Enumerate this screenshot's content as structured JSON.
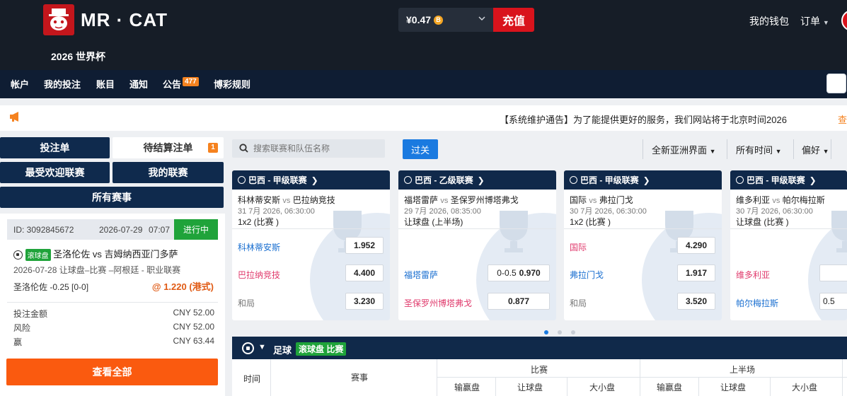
{
  "header": {
    "brand": "MR · CAT",
    "subtitle": "2026 世界杯",
    "balance": "¥0.47",
    "coin_symbol": "B",
    "recharge_label": "充值",
    "wallet_label": "我的钱包",
    "orders_label": "订单"
  },
  "nav": {
    "items": [
      "帐户",
      "我的投注",
      "账目",
      "通知",
      "公告",
      "博彩规则"
    ],
    "announcement_badge": "477"
  },
  "announcement": {
    "text": "【系统维护通告】为了能提供更好的服务，我们网站将于北京时间2026",
    "link": "查"
  },
  "left_panel": {
    "tabs": {
      "bet_slip": "投注单",
      "pending": "待结算注单",
      "pending_count": "1",
      "popular": "最受欢迎联赛",
      "my_leagues": "我的联赛",
      "all_matches": "所有赛事"
    },
    "bet": {
      "id": "ID: 3092845672",
      "date": "2026-07-29",
      "time": "07:07",
      "status": "进行中",
      "live_tag": "滚球盘",
      "match": "圣洛伦佐 vs 吉姆纳西亚门多萨",
      "detail": "2026-07-28 让球盘–比赛 –阿根廷 - 职业联赛",
      "selection": "圣洛伦佐 -0.25 [0-0]",
      "odds": "@ 1.220 (港式)",
      "stake_label": "投注金额",
      "stake_value": "CNY 52.00",
      "risk_label": "风险",
      "risk_value": "CNY 52.00",
      "win_label": "赢",
      "win_value": "CNY 63.44"
    },
    "view_all": "查看全部"
  },
  "toolbar": {
    "search_placeholder": "搜索联赛和队伍名称",
    "filter_label": "过关",
    "view_select": "全新亚洲界面",
    "time_select": "所有时间",
    "pref_select": "偏好"
  },
  "match_cards": [
    {
      "league": "巴西 - 甲级联赛",
      "home": "科林蒂安斯",
      "away": "巴拉纳竞技",
      "date": "31 7月 2026, 06:30:00",
      "market": "1x2 (比赛 )",
      "rows": [
        {
          "label": "科林蒂安斯",
          "odd": "1.952",
          "handicap": ""
        },
        {
          "label": "巴拉纳竞技",
          "odd": "4.400",
          "handicap": ""
        },
        {
          "label": "和局",
          "odd": "3.230",
          "handicap": ""
        }
      ]
    },
    {
      "league": "巴西 - 乙级联赛",
      "home": "福塔雷萨",
      "away": "圣保罗州博塔弗戈",
      "date": "29 7月 2026, 08:35:00",
      "market": "让球盘 (上半场)",
      "rows": [
        {
          "label": "福塔雷萨",
          "odd": "0.970",
          "handicap": "0-0.5"
        },
        {
          "label": "圣保罗州博塔弗戈",
          "odd": "0.877",
          "handicap": ""
        }
      ]
    },
    {
      "league": "巴西 - 甲级联赛",
      "home": "国际",
      "away": "弗拉门戈",
      "date": "30 7月 2026, 06:30:00",
      "market": "1x2 (比赛 )",
      "rows": [
        {
          "label": "国际",
          "odd": "4.290",
          "handicap": ""
        },
        {
          "label": "弗拉门戈",
          "odd": "1.917",
          "handicap": ""
        },
        {
          "label": "和局",
          "odd": "3.520",
          "handicap": ""
        }
      ]
    },
    {
      "league": "巴西 - 甲级联赛",
      "home": "维多利亚",
      "away": "帕尔梅拉斯",
      "date": "30 7月 2026, 06:30:00",
      "market": "让球盘 (比赛 )",
      "rows": [
        {
          "label": "维多利亚",
          "odd": "",
          "handicap": ""
        },
        {
          "label": "帕尔梅拉斯",
          "odd": "",
          "handicap": "0.5"
        }
      ]
    }
  ],
  "vs_label": "vs",
  "table": {
    "sport": "足球",
    "live_label": "滚球盘 比赛",
    "col_time": "时间",
    "col_event": "赛事",
    "group_full": "比赛",
    "group_half": "上半场",
    "sub_cols": [
      "输赢盘",
      "让球盘",
      "大小盘",
      "输赢盘",
      "让球盘",
      "大小盘"
    ]
  }
}
